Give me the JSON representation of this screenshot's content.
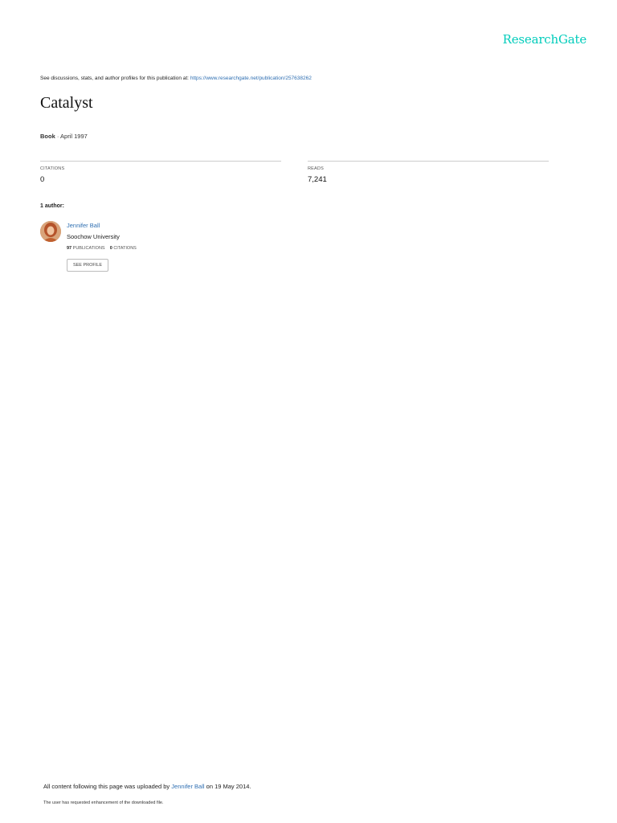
{
  "header": {
    "brand": "ResearchGate"
  },
  "discussion": {
    "prefix": "See discussions, stats, and author profiles for this publication at:",
    "url": "https://www.researchgate.net/publication/257638262"
  },
  "publication": {
    "title": "Catalyst",
    "type": "Book",
    "separator": "·",
    "date": "April 1997"
  },
  "stats": {
    "citations": {
      "label": "CITATIONS",
      "value": "0"
    },
    "reads": {
      "label": "READS",
      "value": "7,241"
    }
  },
  "authors": {
    "heading": "1 author:",
    "list": [
      {
        "name": "Jennifer Ball",
        "affiliation": "Soochow University",
        "publications_count": "97",
        "publications_label": "PUBLICATIONS",
        "citations_count": "0",
        "citations_label": "CITATIONS",
        "profile_button": "SEE PROFILE"
      }
    ]
  },
  "footer": {
    "upload_prefix": "All content following this page was uploaded by",
    "uploader": "Jennifer Ball",
    "upload_suffix": "on 19 May 2014.",
    "note": "The user has requested enhancement of the downloaded file."
  },
  "colors": {
    "brand": "#00ccbb",
    "link": "#2f6fb2",
    "divider": "#cccccc"
  }
}
